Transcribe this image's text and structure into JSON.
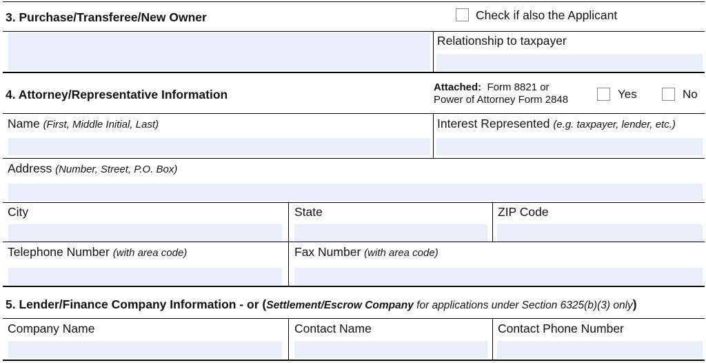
{
  "section3": {
    "title": "3. Purchase/Transferee/New Owner",
    "applicant_checkbox_label": "Check if also the Applicant",
    "relationship_label": "Relationship to taxpayer",
    "name_value": "",
    "relationship_value": ""
  },
  "section4": {
    "title": "4. Attorney/Representative Information",
    "attached_label": "Attached:",
    "attached_text_1": "Form 8821 or",
    "attached_text_2": "Power of Attorney Form 2848",
    "yes_label": "Yes",
    "no_label": "No",
    "name_label": "Name",
    "name_hint": "(First, Middle Initial, Last)",
    "interest_label": "Interest Represented",
    "interest_hint": "(e.g. taxpayer, lender, etc.)",
    "address_label": "Address",
    "address_hint": "(Number, Street, P.O. Box)",
    "city_label": "City",
    "state_label": "State",
    "zip_label": "ZIP Code",
    "phone_label": "Telephone Number",
    "phone_hint": "(with area code)",
    "fax_label": "Fax Number",
    "fax_hint": "(with area code)",
    "values": {
      "name": "",
      "interest": "",
      "address": "",
      "city": "",
      "state": "",
      "zip": "",
      "phone": "",
      "fax": ""
    }
  },
  "section5": {
    "title_bold": "5. Lender/Finance Company Information - or (",
    "title_bold_italic": "Settlement/Escrow Company",
    "title_italic": " for applications under Section 6325(b)(3) only",
    "title_close": ")",
    "company_label": "Company Name",
    "contact_label": "Contact Name",
    "contact_phone_label": "Contact Phone Number",
    "values": {
      "company": "",
      "contact": "",
      "contact_phone": ""
    }
  }
}
